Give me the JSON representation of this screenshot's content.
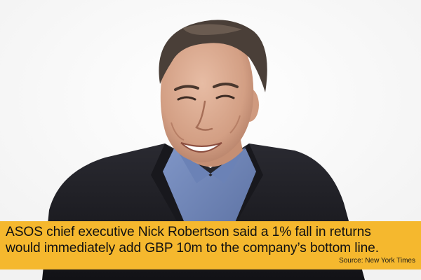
{
  "caption": {
    "quote_line_1": "ASOS chief executive Nick Robertson said a 1% fall in returns",
    "quote_line_2": "would immediately add GBP 10m to the company’s bottom line.",
    "source": "Source: New York Times"
  },
  "colors": {
    "caption_background": "#f5b82e",
    "jacket": "#1d1d22",
    "shirt": "#6f86b8",
    "background": "#fbfbfb"
  }
}
